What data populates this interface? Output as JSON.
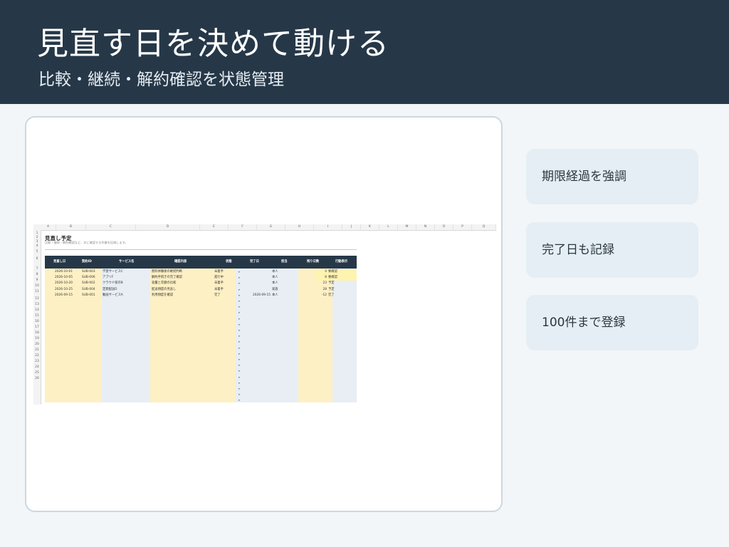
{
  "header": {
    "title": "見直す日を決めて動ける",
    "subtitle": "比較・継続・解約確認を状態管理"
  },
  "features": [
    {
      "label": "期限経過を強調"
    },
    {
      "label": "完了日も記録"
    },
    {
      "label": "100件まで登録"
    }
  ],
  "sheet": {
    "columns": [
      "A",
      "B",
      "C",
      "D",
      "E",
      "F",
      "G",
      "H",
      "I",
      "J",
      "K",
      "L",
      "M",
      "N",
      "O",
      "P",
      "Q"
    ],
    "row_numbers": [
      "1",
      "2",
      "3",
      "4",
      "5",
      "6",
      "7",
      "8",
      "9",
      "10",
      "11",
      "12",
      "13",
      "14",
      "15",
      "16",
      "17",
      "18",
      "19",
      "20",
      "21",
      "22",
      "23",
      "24",
      "25",
      "26"
    ],
    "title": "見直し予定",
    "description": "比較・継続・解約確認など、次に確認する作業を記録します。",
    "headers": [
      "見直し日",
      "契約ID",
      "サービス名",
      "確認内容",
      "状態",
      "完了日",
      "担当",
      "残り日数",
      "行動表示"
    ],
    "rows": [
      {
        "date": "2026-10-01",
        "id": "SUB-003",
        "service": "学習サービスC",
        "content": "無料体験後の継続判断",
        "status": "未着手",
        "done": "",
        "owner": "本人",
        "days": "4",
        "action": "要確認",
        "highlight": true
      },
      {
        "date": "2026-10-05",
        "id": "SUB-006",
        "service": "アプリF",
        "content": "解約手続きの完了確認",
        "status": "進行中",
        "done": "",
        "owner": "本人",
        "days": "8",
        "action": "要確認",
        "highlight": true
      },
      {
        "date": "2026-10-20",
        "id": "SUB-002",
        "service": "クラウド保存B",
        "content": "容量と年額の比較",
        "status": "未着手",
        "done": "",
        "owner": "本人",
        "days": "23",
        "action": "予定",
        "highlight": false
      },
      {
        "date": "2026-10-25",
        "id": "SUB-004",
        "service": "定期配送D",
        "content": "配送頻度の見直し",
        "status": "未着手",
        "done": "",
        "owner": "家族",
        "days": "28",
        "action": "予定",
        "highlight": false
      },
      {
        "date": "2026-09-15",
        "id": "SUB-001",
        "service": "動画サービスA",
        "content": "利用頻度を確認",
        "status": "完了",
        "done": "2026-09-15",
        "owner": "本人",
        "days": "-12",
        "action": "完了",
        "highlight": false
      }
    ],
    "dropdown_marker": "▾",
    "colors": {
      "header": "#263848",
      "yellow": "#fdf0c4",
      "blue": "#e8eef4",
      "highlight": "#fff3b0"
    }
  }
}
